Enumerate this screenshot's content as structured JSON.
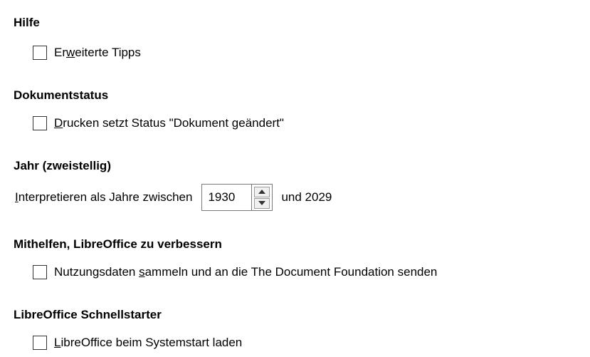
{
  "sections": {
    "help": {
      "title": "Hilfe",
      "option": {
        "pre": "Er",
        "mnemonic": "w",
        "post": "eiterte Tipps",
        "checked": false
      }
    },
    "docstatus": {
      "title": "Dokumentstatus",
      "option": {
        "pre": "",
        "mnemonic": "D",
        "post": "rucken setzt Status \"Dokument geändert\"",
        "checked": false
      }
    },
    "year": {
      "title": "Jahr (zweistellig)",
      "label_mnemonic": "I",
      "label_rest": "nterpretieren als Jahre zwischen",
      "value": "1930",
      "suffix": "und 2029",
      "up_icon": "triangle-up-icon",
      "down_icon": "triangle-down-icon"
    },
    "help_improve": {
      "title": "Mithelfen, LibreOffice zu verbessern",
      "option": {
        "pre": "Nutzungsdaten ",
        "mnemonic": "s",
        "post": "ammeln und an die The Document Foundation senden",
        "checked": false
      }
    },
    "quickstarter": {
      "title": "LibreOffice Schnellstarter",
      "option": {
        "pre": "",
        "mnemonic": "L",
        "post": "ibreOffice beim Systemstart laden",
        "checked": false
      }
    }
  }
}
